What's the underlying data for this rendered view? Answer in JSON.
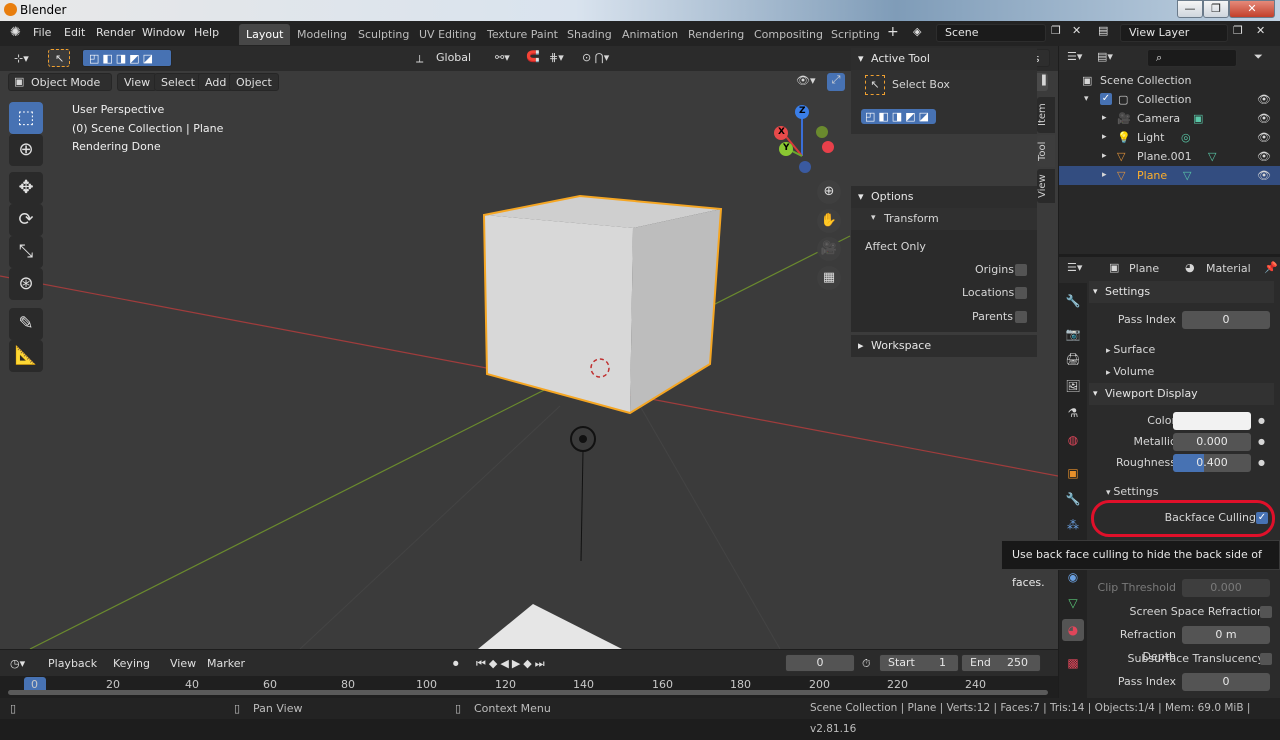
{
  "window": {
    "title": "Blender",
    "minimize": "—",
    "maximize": "❐",
    "close": "✕"
  },
  "menubar": {
    "menus": [
      "File",
      "Edit",
      "Render",
      "Window",
      "Help"
    ],
    "workspaces": [
      "Layout",
      "Modeling",
      "Sculpting",
      "UV Editing",
      "Texture Paint",
      "Shading",
      "Animation",
      "Rendering",
      "Compositing",
      "Scripting"
    ],
    "active_workspace": "Layout",
    "add_workspace": "+",
    "scene": "Scene",
    "view_layer": "View Layer"
  },
  "viewport_header": {
    "mode": "Object Mode",
    "menus": [
      "View",
      "Select",
      "Add",
      "Object"
    ],
    "orientation": "Global",
    "options": "Options"
  },
  "viewport_overlay": {
    "line1": "User Perspective",
    "line2": "(0) Scene Collection | Plane",
    "line3": "Rendering Done",
    "axes": {
      "x": "X",
      "y": "Y",
      "z": "Z"
    }
  },
  "npanel": {
    "active_tool_header": "Active Tool",
    "tool_name": "Select Box",
    "options_header": "Options",
    "transform_header": "Transform",
    "affect_only": "Affect Only",
    "origins": "Origins",
    "locations": "Locations",
    "parents": "Parents",
    "workspace_header": "Workspace",
    "tabs": [
      "Item",
      "Tool",
      "View"
    ]
  },
  "outliner": {
    "root": "Scene Collection",
    "collection": "Collection",
    "items": [
      "Camera",
      "Light",
      "Plane.001",
      "Plane"
    ],
    "selected": "Plane"
  },
  "properties": {
    "object": "Plane",
    "context": "Material",
    "settings_header": "Settings",
    "pass_index_label": "Pass Index",
    "pass_index": "0",
    "surface": "Surface",
    "volume": "Volume",
    "viewport_display": "Viewport Display",
    "color_label": "Color",
    "metallic_label": "Metallic",
    "metallic": "0.000",
    "roughness_label": "Roughness",
    "roughness": "0.400",
    "roughness_fraction": 0.4,
    "sub_settings": "Settings",
    "backface_culling": "Backface Culling",
    "clip_threshold_label": "Clip Threshold",
    "clip_threshold": "0.000",
    "ssr_label": "Screen Space Refraction",
    "refraction_depth_label": "Refraction Depth",
    "refraction_depth": "0 m",
    "subsurface_label": "Subsurface Translucency",
    "pass_index2_label": "Pass Index",
    "pass_index2": "0"
  },
  "tooltip": "Use back face culling to hide the back side of faces.",
  "timeline": {
    "playback": "Playback",
    "keying": "Keying",
    "view": "View",
    "marker": "Marker",
    "current_frame": "0",
    "start_label": "Start",
    "start": "1",
    "end_label": "End",
    "end": "250",
    "ticks": [
      "0",
      "20",
      "40",
      "60",
      "80",
      "100",
      "120",
      "140",
      "160",
      "180",
      "200",
      "220",
      "240"
    ]
  },
  "statusbar": {
    "pan": "Pan View",
    "context": "Context Menu",
    "stats": "Scene Collection | Plane | Verts:12 | Faces:7 | Tris:14 | Objects:1/4 | Mem: 69.0 MiB | v2.81.16"
  },
  "colors": {
    "accent": "#4772b3",
    "selection": "#f5a623",
    "highlight_ring": "#e0102a"
  }
}
